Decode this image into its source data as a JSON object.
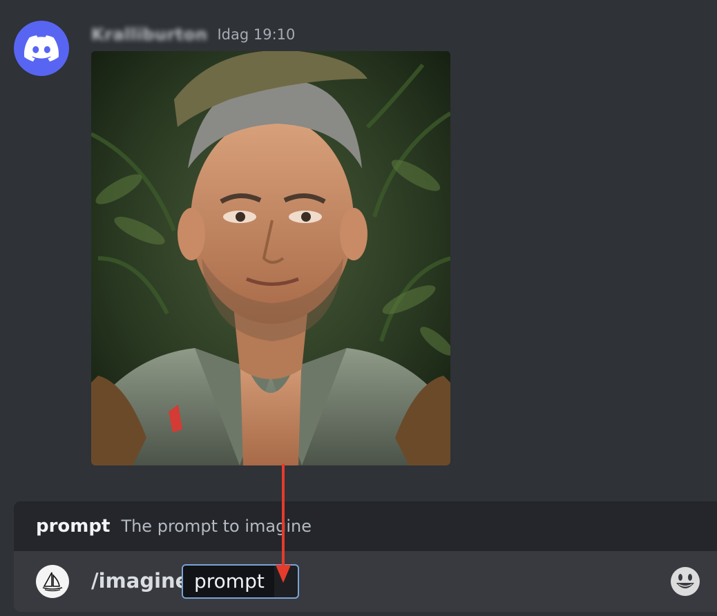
{
  "message": {
    "username": "Kralliburton",
    "timestamp": "Idag 19:10",
    "attachment_icon": "portrait-image"
  },
  "command_option": {
    "name": "prompt",
    "description": "The prompt to imagine"
  },
  "composer": {
    "command": "/imagine",
    "option_label": "prompt",
    "bot_icon": "midjourney-boat-icon",
    "emoji_icon": "smiley-face-icon"
  },
  "colors": {
    "avatar": "#5865f2",
    "annotation_arrow": "#e53b2c",
    "chip_border": "#7aa4d6"
  }
}
